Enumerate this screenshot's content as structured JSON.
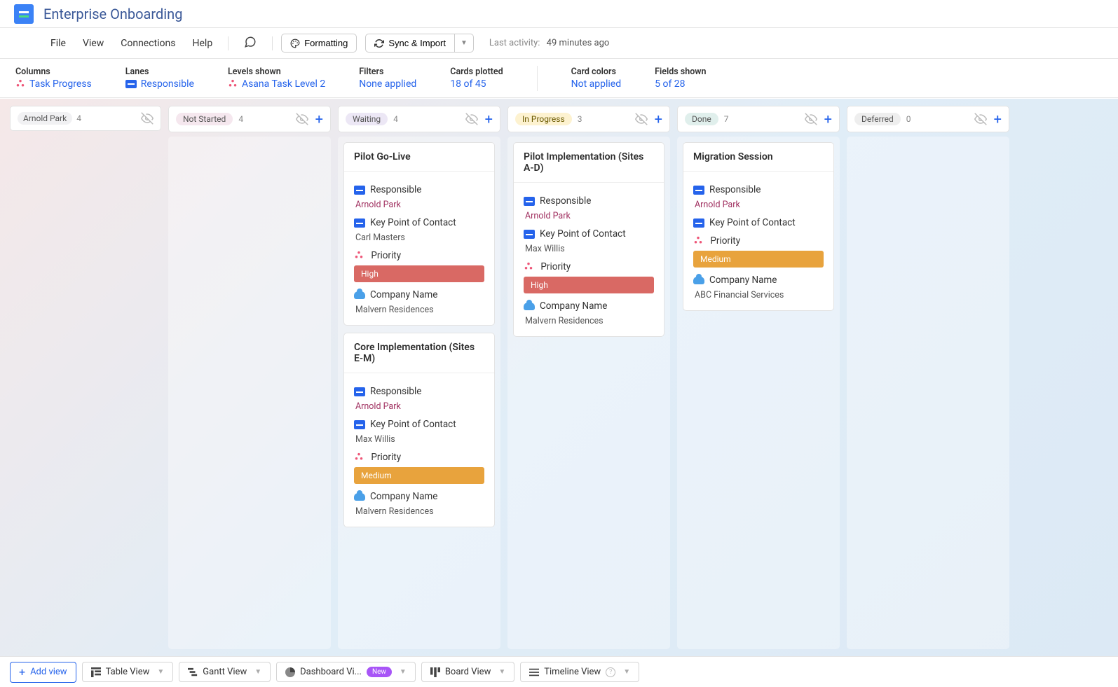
{
  "header": {
    "title": "Enterprise Onboarding"
  },
  "menu": {
    "file": "File",
    "view": "View",
    "connections": "Connections",
    "help": "Help",
    "formatting": "Formatting",
    "sync": "Sync & Import",
    "last_activity_label": "Last activity:",
    "last_activity_time": "49 minutes ago"
  },
  "filters": {
    "columns": {
      "label": "Columns",
      "value": "Task Progress"
    },
    "lanes": {
      "label": "Lanes",
      "value": "Responsible"
    },
    "levels": {
      "label": "Levels shown",
      "value": "Asana Task Level 2"
    },
    "filters": {
      "label": "Filters",
      "value": "None applied"
    },
    "cards": {
      "label": "Cards plotted",
      "value": "18 of 45"
    },
    "colors": {
      "label": "Card colors",
      "value": "Not applied"
    },
    "fields": {
      "label": "Fields shown",
      "value": "5 of 28"
    }
  },
  "lane": {
    "name": "Arnold Park",
    "count": "4"
  },
  "columns": [
    {
      "name": "Not Started",
      "count": "4",
      "tag_class": "tag-notstarted",
      "cards": []
    },
    {
      "name": "Waiting",
      "count": "4",
      "tag_class": "tag-waiting",
      "cards": [
        {
          "title": "Pilot Go-Live",
          "responsible": "Arnold Park",
          "contact": "Carl Masters",
          "priority": "High",
          "priority_class": "priority-high",
          "company": "Malvern Residences"
        },
        {
          "title": "Core Implementation (Sites E-M)",
          "responsible": "Arnold Park",
          "contact": "Max Willis",
          "priority": "Medium",
          "priority_class": "priority-medium",
          "company": "Malvern Residences"
        }
      ]
    },
    {
      "name": "In Progress",
      "count": "3",
      "tag_class": "tag-inprogress",
      "cards": [
        {
          "title": "Pilot Implementation (Sites A-D)",
          "responsible": "Arnold Park",
          "contact": "Max Willis",
          "priority": "High",
          "priority_class": "priority-high",
          "company": "Malvern Residences"
        }
      ]
    },
    {
      "name": "Done",
      "count": "7",
      "tag_class": "tag-done",
      "cards": [
        {
          "title": "Migration Session",
          "responsible": "Arnold Park",
          "contact": "",
          "priority": "Medium",
          "priority_class": "priority-medium",
          "company": "ABC Financial Services"
        }
      ]
    },
    {
      "name": "Deferred",
      "count": "0",
      "tag_class": "tag-deferred",
      "cards": []
    }
  ],
  "field_labels": {
    "responsible": "Responsible",
    "contact": "Key Point of Contact",
    "priority": "Priority",
    "company": "Company Name"
  },
  "tabs": {
    "add": "Add view",
    "table": "Table View",
    "gantt": "Gantt View",
    "dashboard": "Dashboard Vi...",
    "new_badge": "New",
    "board": "Board View",
    "timeline": "Timeline View"
  }
}
